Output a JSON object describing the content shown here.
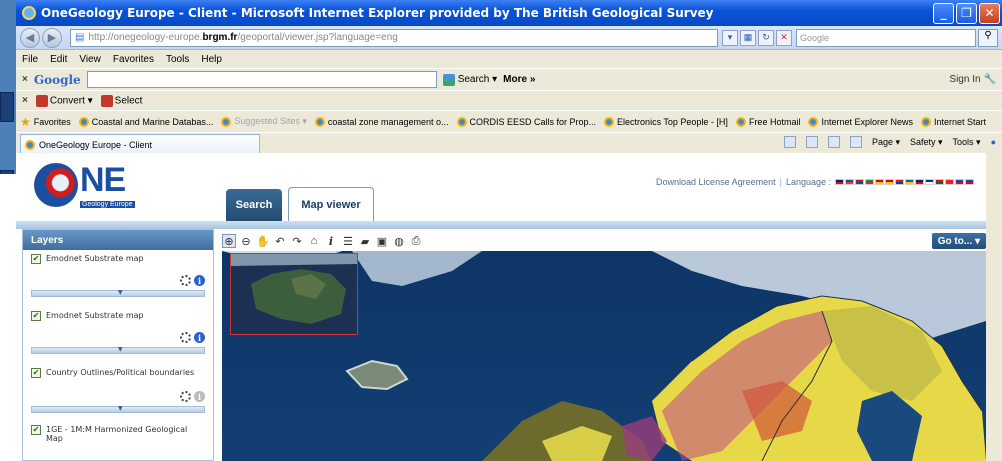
{
  "window": {
    "title": "OneGeology Europe - Client - Microsoft Internet Explorer provided by The British Geological Survey",
    "min": "_",
    "max": "❐",
    "close": "✕"
  },
  "address": {
    "url_prefix": "http://onegeology-europe.",
    "url_domain": "brgm.fr",
    "url_suffix": "/geoportal/viewer.jsp?language=eng",
    "search_placeholder": "Google"
  },
  "menu": [
    "File",
    "Edit",
    "View",
    "Favorites",
    "Tools",
    "Help"
  ],
  "google_toolbar": {
    "close": "×",
    "logo": "Google",
    "search_label": "Search ▾",
    "more_label": "More »",
    "signin_label": "Sign In"
  },
  "convert_toolbar": {
    "close": "×",
    "convert_label": "Convert ▾",
    "select_label": "Select"
  },
  "favorites_bar": {
    "favorites_label": "Favorites",
    "items": [
      "Coastal and Marine Databas...",
      "Suggested Sites ▾",
      "coastal zone management o...",
      "CORDIS EESD Calls for Prop...",
      "Electronics Top People - [H]",
      "Free Hotmail",
      "Internet Explorer News",
      "Internet Start"
    ]
  },
  "tabs": {
    "active_tab": "OneGeology Europe - Client"
  },
  "command_bar": [
    "Page ▾",
    "Safety ▾",
    "Tools ▾"
  ],
  "site": {
    "logo_text": "NE",
    "logo_sub": "Geology Europe",
    "license_link": "Download License Agreement",
    "language_label": "Language :",
    "flag_colors": [
      "#012169",
      "#c8102e",
      "#0055a4",
      "#ef3340",
      "#ae1c28",
      "#21468b",
      "#009246",
      "#ce2b37",
      "#c60b1e",
      "#ffc400",
      "#dd0000",
      "#ffce00",
      "#d7141a",
      "#11457e",
      "#006aa7",
      "#fecc00",
      "#002664",
      "#c8102e",
      "#003580",
      "#ffffff",
      "#ff0000",
      "#046a38",
      "#da291c",
      "#ee1c25",
      "#0b4ea2",
      "#c8102e",
      "#0052b4",
      "#d80027"
    ]
  },
  "nav_tabs": {
    "search": "Search",
    "map_viewer": "Map viewer"
  },
  "layers_panel": {
    "title": "Layers",
    "items": [
      {
        "name": "Emodnet Substrate map",
        "checked": true
      },
      {
        "name": "Emodnet Substrate map",
        "checked": true
      },
      {
        "name": "Country Outlines/Political boundaries",
        "checked": true
      },
      {
        "name": "1GE - 1M:M Harmonized Geological Map",
        "checked": true
      }
    ]
  },
  "map_toolbar": {
    "goto_label": "Go to... ▾"
  }
}
